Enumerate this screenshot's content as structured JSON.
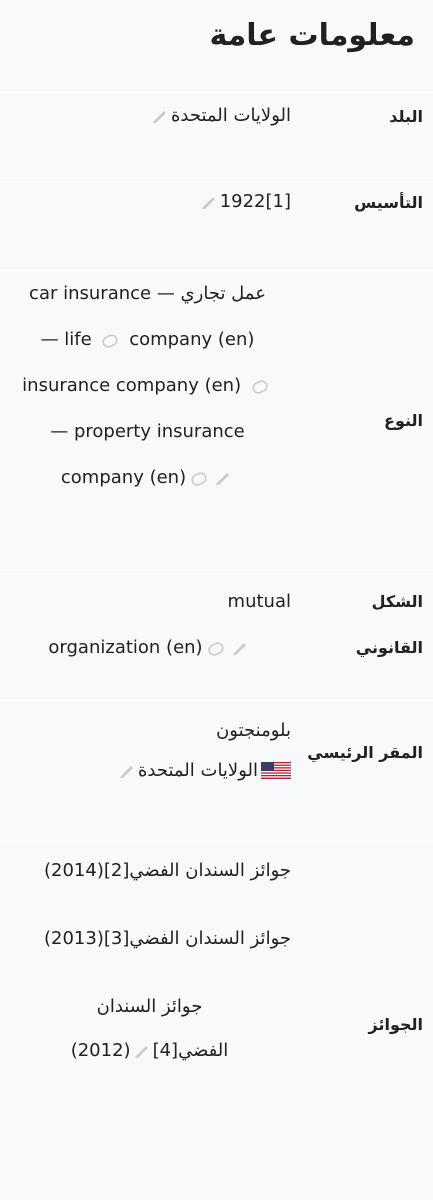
{
  "title": "معلومات عامة",
  "rows": {
    "country": {
      "label": "البلد",
      "value": "الولايات المتحدة"
    },
    "founded": {
      "label": "التأسيس",
      "value": "1922[1]"
    },
    "type": {
      "label": "النوع",
      "lines": [
        "عمل تجاري — car insurance",
        "company (en)",
        "— life",
        "insurance company (en)",
        "— property insurance",
        "company (en)"
      ]
    },
    "legal_form": {
      "label_line1": "الشكل",
      "label_line2": "القانوني",
      "line1": "mutual",
      "line2": "organization (en)"
    },
    "hq": {
      "label": "المقر الرئيسي",
      "city": "بلومنجتون",
      "country": "الولايات المتحدة"
    },
    "awards": {
      "label": "الجوائز",
      "items": [
        "جوائز السندان الفضي[2](2014)",
        "جوائز السندان الفضي[3](2013)",
        "جوائز السندان",
        "الفضي[4]",
        "(2012)"
      ]
    }
  },
  "icons": {
    "pencil": "pencil-icon",
    "wikidata": "wikidata-link-icon",
    "flag": "us-flag-icon"
  },
  "colors": {
    "background": "#f8f9fa",
    "text": "#202122",
    "icon": "#c8ccd1"
  }
}
